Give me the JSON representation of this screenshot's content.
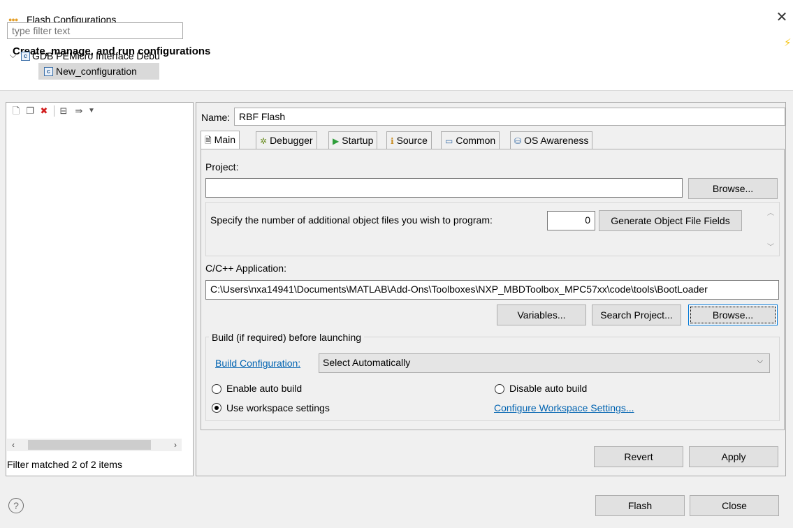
{
  "window": {
    "title": "Flash Configurations",
    "heading": "Create, manage, and run configurations"
  },
  "left": {
    "toolbar": [
      "new-configuration-icon",
      "duplicate-icon",
      "delete-icon",
      "collapse-all-icon",
      "filter-icon",
      "view-menu-icon"
    ],
    "filter_placeholder": "type filter text",
    "tree": [
      {
        "label": "GDB PEMicro Interface Debu",
        "expanded": true
      },
      {
        "label": "New_configuration",
        "selected": true
      }
    ],
    "status": "Filter matched 2 of 2 items"
  },
  "config": {
    "name_label": "Name:",
    "name_value": "RBF Flash",
    "tabs": [
      {
        "label": "Main",
        "icon": "main-tab-icon"
      },
      {
        "label": "Debugger",
        "icon": "debugger-icon"
      },
      {
        "label": "Startup",
        "icon": "startup-icon"
      },
      {
        "label": "Source",
        "icon": "source-icon"
      },
      {
        "label": "Common",
        "icon": "common-icon"
      },
      {
        "label": "OS Awareness",
        "icon": "os-awareness-icon"
      }
    ],
    "main": {
      "project_label": "Project:",
      "project_value": "",
      "browse": "Browse...",
      "obj_files_text": "Specify the number of additional object files you wish to program:",
      "obj_files_value": "0",
      "generate_button": "Generate Object File Fields",
      "app_label": "C/C++ Application:",
      "app_value": "C:\\Users\\nxa14941\\Documents\\MATLAB\\Add-Ons\\Toolboxes\\NXP_MBDToolbox_MPC57xx\\code\\tools\\BootLoader",
      "variables_button": "Variables...",
      "search_project_button": "Search Project...",
      "browse2": "Browse...",
      "build_group_label": "Build (if required) before launching",
      "build_config_link": "Build Configuration:",
      "build_config_value": "Select Automatically",
      "enable_auto_build": "Enable auto build",
      "disable_auto_build": "Disable auto build",
      "use_workspace": "Use workspace settings",
      "configure_workspace_link": "Configure Workspace Settings..."
    },
    "revert": "Revert",
    "apply": "Apply"
  },
  "footer": {
    "flash": "Flash",
    "close": "Close"
  }
}
